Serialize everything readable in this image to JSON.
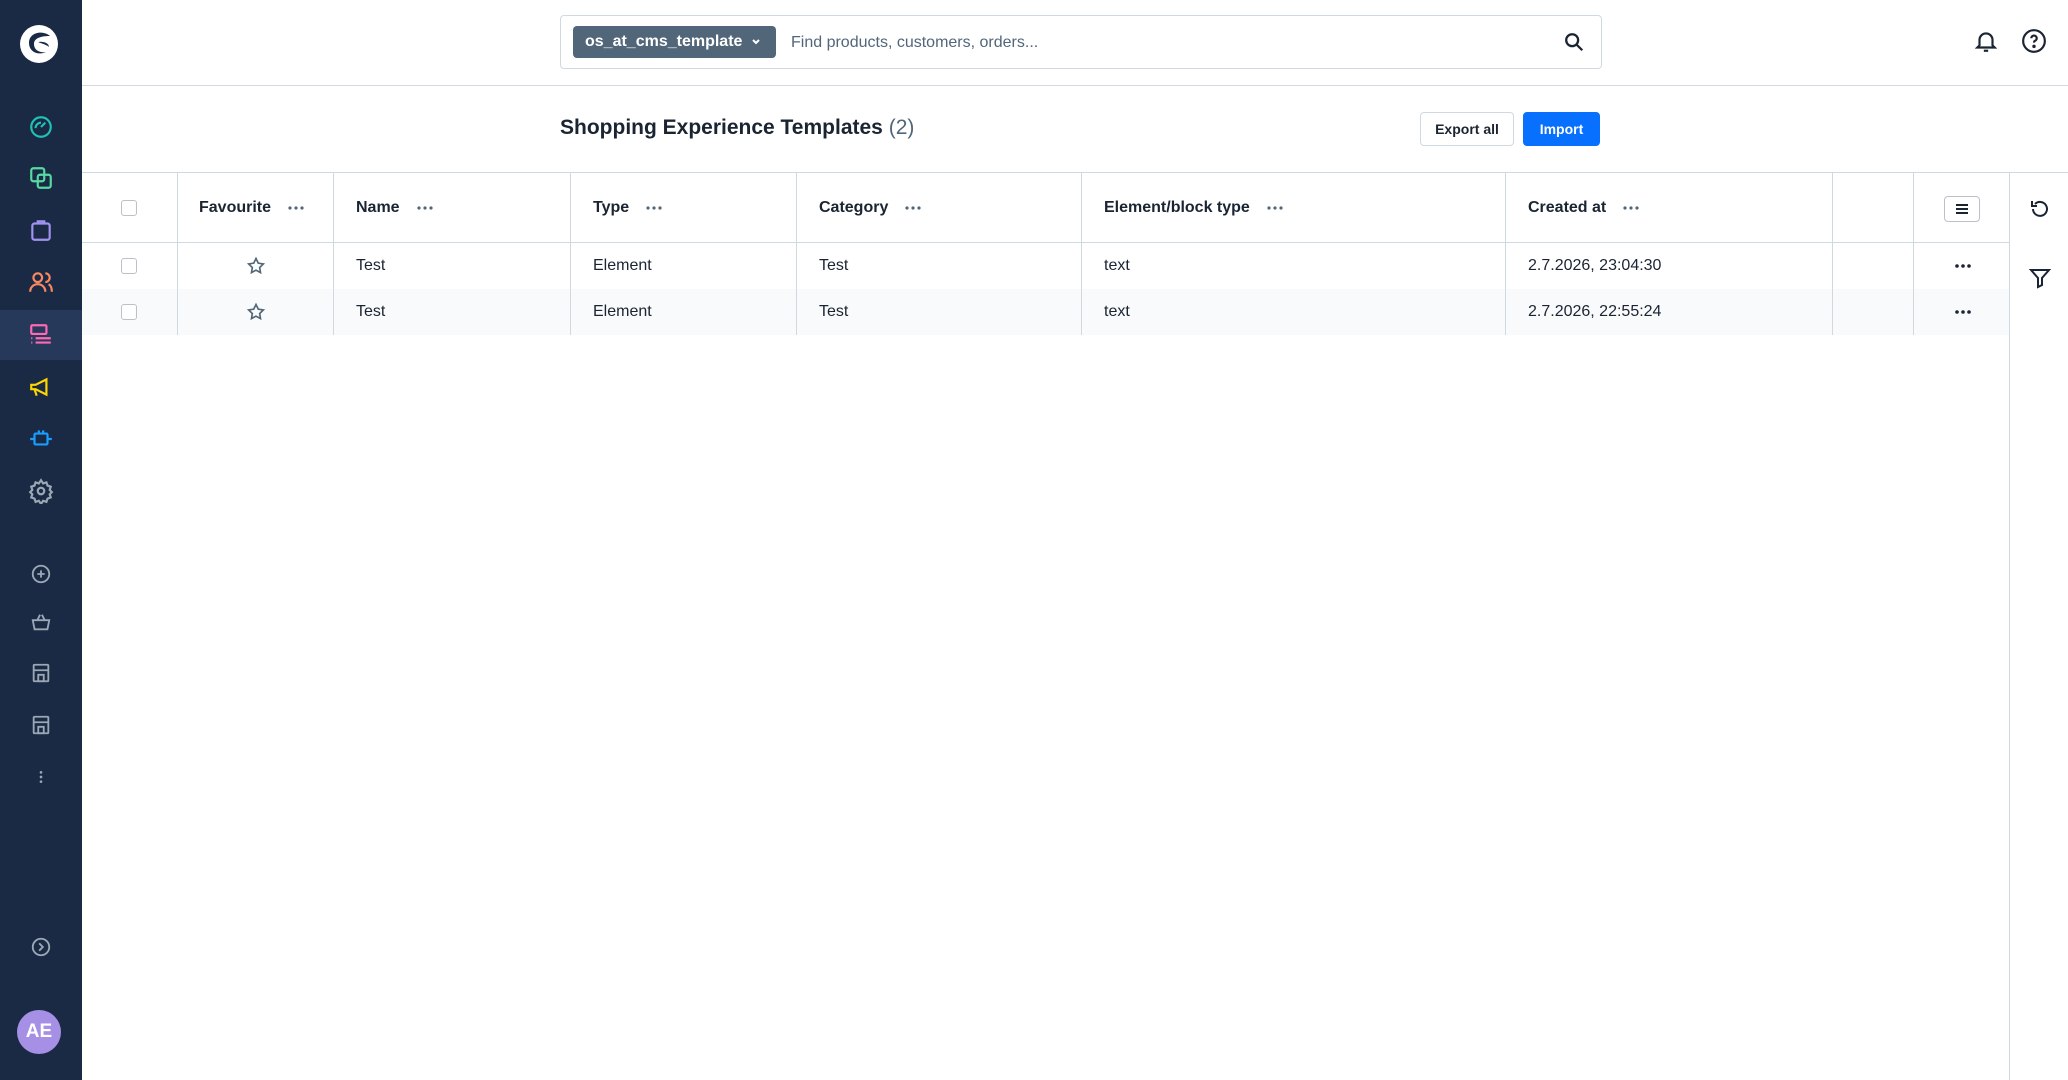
{
  "sidebar": {
    "items": [
      {
        "icon": "dashboard-icon",
        "color": "#1fc1b4"
      },
      {
        "icon": "catalogue-icon",
        "color": "#57d9a3"
      },
      {
        "icon": "orders-icon",
        "color": "#a092f0"
      },
      {
        "icon": "customers-icon",
        "color": "#f88962"
      },
      {
        "icon": "content-icon",
        "color": "#ff68b4",
        "active": true
      },
      {
        "icon": "marketing-icon",
        "color": "#ffd700"
      },
      {
        "icon": "extensions-icon",
        "color": "#189eff"
      },
      {
        "icon": "settings-icon",
        "color": "#9aa8b5"
      },
      {
        "icon": "add-circle-icon",
        "color": "#9aa8b5"
      },
      {
        "icon": "basket-icon",
        "color": "#9aa8b5"
      },
      {
        "icon": "storefront-icon",
        "color": "#9aa8b5"
      },
      {
        "icon": "storefront-icon",
        "color": "#9aa8b5"
      },
      {
        "icon": "more-vertical-icon",
        "color": "#9aa8b5"
      },
      {
        "icon": "collapse-icon",
        "color": "#9aa8b5"
      }
    ],
    "avatar_initials": "AE",
    "avatar_color": "#a690e6"
  },
  "search": {
    "type_label": "os_at_cms_template",
    "placeholder": "Find products, customers, orders..."
  },
  "smartbar": {
    "title": "Shopping Experience Templates",
    "count": "(2)",
    "export_label": "Export all",
    "import_label": "Import",
    "primary_color": "#0870ff"
  },
  "grid": {
    "columns": [
      "Favourite",
      "Name",
      "Type",
      "Category",
      "Element/block type",
      "Created at"
    ],
    "rows": [
      {
        "name": "Test",
        "type": "Element",
        "category": "Test",
        "element_type": "text",
        "created_at": "2.7.2026, 23:04:30"
      },
      {
        "name": "Test",
        "type": "Element",
        "category": "Test",
        "element_type": "text",
        "created_at": "2.7.2026, 22:55:24"
      }
    ]
  }
}
